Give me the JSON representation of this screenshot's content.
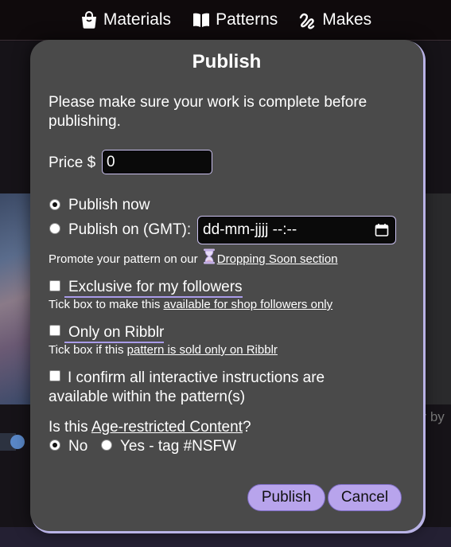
{
  "nav": {
    "items": [
      {
        "label": "Materials",
        "icon": "bag-icon"
      },
      {
        "label": "Patterns",
        "icon": "book-icon"
      },
      {
        "label": "Makes",
        "icon": "yarn-icon"
      }
    ]
  },
  "background": {
    "right_text": "er by"
  },
  "modal": {
    "title": "Publish",
    "intro": "Please make sure your work is complete before publishing.",
    "price_label": "Price $",
    "price_value": "0",
    "publish_now_label": "Publish now",
    "publish_on_label": "Publish on (GMT):",
    "date_placeholder": "dd-mm-jjjj --:--",
    "promote_prefix": "Promote your pattern on our",
    "promote_link": "Dropping Soon section",
    "exclusive_label": "Exclusive for my followers",
    "exclusive_hint_prefix": "Tick box to make this",
    "exclusive_hint_link": "available for shop followers only",
    "only_ribblr_label": "Only on Ribblr",
    "only_ribblr_hint_prefix": "Tick box if this",
    "only_ribblr_hint_link": "pattern is sold only on Ribblr",
    "confirm_label": "I confirm all interactive instructions are available within the pattern(s)",
    "age_prefix": "Is this",
    "age_link": "Age-restricted Content",
    "age_suffix": "?",
    "age_no_label": "No",
    "age_yes_label": "Yes - tag #NSFW",
    "publish_button": "Publish",
    "cancel_button": "Cancel"
  },
  "colors": {
    "modal_bg": "#4a4a4a",
    "button_bg": "#b8a4ec",
    "accent_border": "#c9c0ee"
  }
}
